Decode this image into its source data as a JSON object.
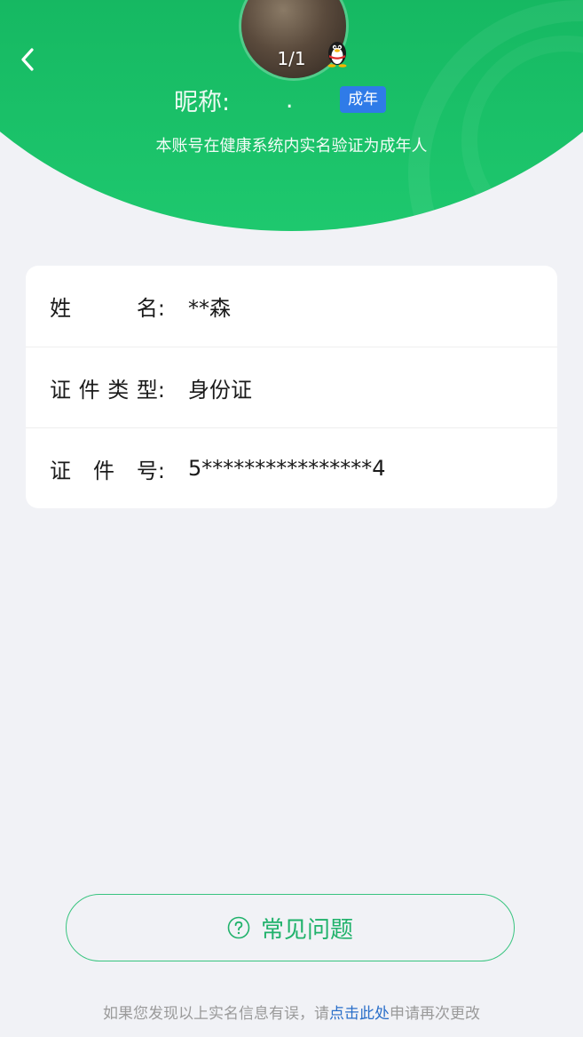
{
  "header": {
    "page_indicator": "1/1",
    "nickname_label": "昵称:",
    "nickname_value": ".",
    "badge": "成年",
    "subtitle": "本账号在健康系统内实名验证为成年人",
    "colors": {
      "header_green": "#13b35e",
      "badge_blue": "#2f7be8"
    },
    "icons": [
      "back-arrow-icon",
      "qq-penguin-icon"
    ]
  },
  "info": {
    "rows": [
      {
        "label_chars": [
          "姓",
          "名:"
        ],
        "value": "**森"
      },
      {
        "label_chars": [
          "证",
          "件",
          "类",
          "型:"
        ],
        "value": "身份证"
      },
      {
        "label_chars": [
          "证",
          "件",
          "号:"
        ],
        "value": "5****************4"
      }
    ]
  },
  "faq": {
    "label": "常见问题",
    "icon": "question-circle-icon",
    "accent": "#20b26b"
  },
  "footer": {
    "prefix": "如果您发现以上实名信息有误，请",
    "link": "点击此处",
    "suffix": "申请再次更改",
    "link_color": "#2a6fc9"
  }
}
